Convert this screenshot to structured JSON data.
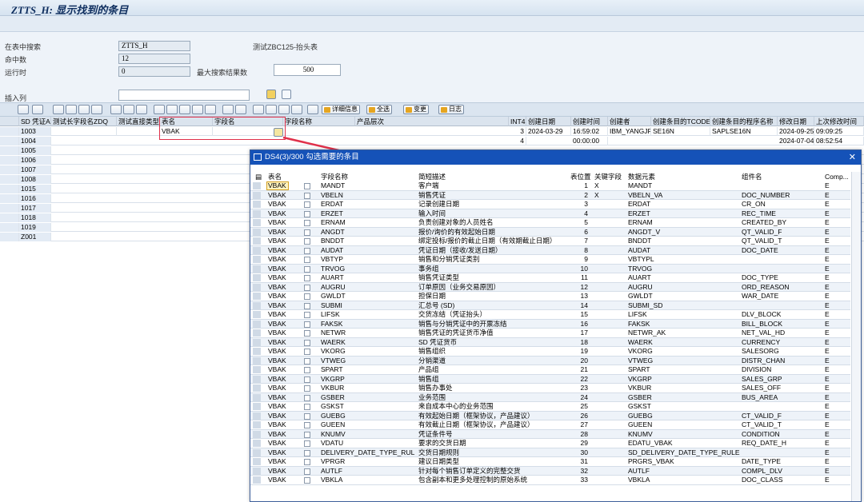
{
  "title": "ZTTS_H: 显示找到的条目",
  "toolbar_icons": [
    "refresh-icon",
    "filter-icon",
    "layout-icon",
    "export-icon"
  ],
  "form": {
    "search_table_label": "在表中搜索",
    "search_table_value": "ZTTS_H",
    "search_table_desc": "测试ZBC125-抬头表",
    "hits_label": "命中数",
    "hits_value": "12",
    "runtime_label": "运行时",
    "runtime_value": "0",
    "max_results_label": "最大搜索结果数",
    "max_results_value": "500",
    "insert_col_label": "插入列"
  },
  "alv_buttons": {
    "details": "详细信息",
    "select_all": "全选",
    "change": "变更",
    "log": "日志"
  },
  "grid": {
    "headers": [
      "SD 凭证A",
      "测试长字段名ZDQ",
      "测试直接类型",
      "表名",
      "字段名",
      "字段名称",
      "产品层次",
      "INT4",
      "创建日期",
      "创建时间",
      "创建者",
      "创建条目的TCODE",
      "创建条目的程序名称",
      "修改日期",
      "上次修改时间"
    ],
    "rows": [
      {
        "id": "1003",
        "table": "VBAK",
        "int4": "3",
        "cdate": "2024-03-29",
        "ctime": "16:59:02",
        "creator": "IBM_YANGJF",
        "tcode": "SE16N",
        "prog": "SAPLSE16N",
        "mdate": "2024-09-25",
        "mtime": "09:09:25"
      },
      {
        "id": "1004",
        "table": "",
        "int4": "4",
        "cdate": "",
        "ctime": "00:00:00",
        "creator": "",
        "tcode": "",
        "prog": "",
        "mdate": "2024-07-04",
        "mtime": "08:52:54"
      },
      {
        "id": "1005"
      },
      {
        "id": "1006"
      },
      {
        "id": "1007"
      },
      {
        "id": "1008"
      },
      {
        "id": "1015"
      },
      {
        "id": "1016"
      },
      {
        "id": "1017"
      },
      {
        "id": "1018"
      },
      {
        "id": "1019"
      },
      {
        "id": "Z001"
      }
    ]
  },
  "popup": {
    "title": "DS4(3)/300 勾选需要的条目",
    "headers": [
      "表名",
      "字段名称",
      "简短描述",
      "表位置",
      "关键字段",
      "数据元素",
      "组件名",
      "Comp..."
    ],
    "rows": [
      [
        "VBAK",
        "MANDT",
        "客户端",
        "1",
        "X",
        "MANDT",
        "",
        "E"
      ],
      [
        "VBAK",
        "VBELN",
        "销售凭证",
        "2",
        "X",
        "VBELN_VA",
        "DOC_NUMBER",
        "E"
      ],
      [
        "VBAK",
        "ERDAT",
        "记录创建日期",
        "3",
        "",
        "ERDAT",
        "CR_ON",
        "E"
      ],
      [
        "VBAK",
        "ERZET",
        "输入时间",
        "4",
        "",
        "ERZET",
        "REC_TIME",
        "E"
      ],
      [
        "VBAK",
        "ERNAM",
        "负责创建对象的人员姓名",
        "5",
        "",
        "ERNAM",
        "CREATED_BY",
        "E"
      ],
      [
        "VBAK",
        "ANGDT",
        "报价/询价的有效起始日期",
        "6",
        "",
        "ANGDT_V",
        "QT_VALID_F",
        "E"
      ],
      [
        "VBAK",
        "BNDDT",
        "绑定投标/报价的截止日期（有效期截止日期）",
        "7",
        "",
        "BNDDT",
        "QT_VALID_T",
        "E"
      ],
      [
        "VBAK",
        "AUDAT",
        "凭证日期（接收/发送日期）",
        "8",
        "",
        "AUDAT",
        "DOC_DATE",
        "E"
      ],
      [
        "VBAK",
        "VBTYP",
        "销售和分销凭证类别",
        "9",
        "",
        "VBTYPL",
        "",
        "E"
      ],
      [
        "VBAK",
        "TRVOG",
        "事务组",
        "10",
        "",
        "TRVOG",
        "",
        "E"
      ],
      [
        "VBAK",
        "AUART",
        "销售凭证类型",
        "11",
        "",
        "AUART",
        "DOC_TYPE",
        "E"
      ],
      [
        "VBAK",
        "AUGRU",
        "订单原因（业务交易原因）",
        "12",
        "",
        "AUGRU",
        "ORD_REASON",
        "E"
      ],
      [
        "VBAK",
        "GWLDT",
        "担保日期",
        "13",
        "",
        "GWLDT",
        "WAR_DATE",
        "E"
      ],
      [
        "VBAK",
        "SUBMI",
        "汇总号 (SD)",
        "14",
        "",
        "SUBMI_SD",
        "",
        "E"
      ],
      [
        "VBAK",
        "LIFSK",
        "交货冻结（凭证抬头）",
        "15",
        "",
        "LIFSK",
        "DLV_BLOCK",
        "E"
      ],
      [
        "VBAK",
        "FAKSK",
        "销售与分销凭证中的开票冻结",
        "16",
        "",
        "FAKSK",
        "BILL_BLOCK",
        "E"
      ],
      [
        "VBAK",
        "NETWR",
        "销售凭证的凭证货币净值",
        "17",
        "",
        "NETWR_AK",
        "NET_VAL_HD",
        "E"
      ],
      [
        "VBAK",
        "WAERK",
        "SD 凭证货币",
        "18",
        "",
        "WAERK",
        "CURRENCY",
        "E"
      ],
      [
        "VBAK",
        "VKORG",
        "销售组织",
        "19",
        "",
        "VKORG",
        "SALESORG",
        "E"
      ],
      [
        "VBAK",
        "VTWEG",
        "分销渠道",
        "20",
        "",
        "VTWEG",
        "DISTR_CHAN",
        "E"
      ],
      [
        "VBAK",
        "SPART",
        "产品组",
        "21",
        "",
        "SPART",
        "DIVISION",
        "E"
      ],
      [
        "VBAK",
        "VKGRP",
        "销售组",
        "22",
        "",
        "VKGRP",
        "SALES_GRP",
        "E"
      ],
      [
        "VBAK",
        "VKBUR",
        "销售办事处",
        "23",
        "",
        "VKBUR",
        "SALES_OFF",
        "E"
      ],
      [
        "VBAK",
        "GSBER",
        "业务范围",
        "24",
        "",
        "GSBER",
        "BUS_AREA",
        "E"
      ],
      [
        "VBAK",
        "GSKST",
        "来自成本中心的业务范围",
        "25",
        "",
        "GSKST",
        "",
        "E"
      ],
      [
        "VBAK",
        "GUEBG",
        "有效起始日期（框架协议，产品建议）",
        "26",
        "",
        "GUEBG",
        "CT_VALID_F",
        "E"
      ],
      [
        "VBAK",
        "GUEEN",
        "有效截止日期（框架协议，产品建议）",
        "27",
        "",
        "GUEEN",
        "CT_VALID_T",
        "E"
      ],
      [
        "VBAK",
        "KNUMV",
        "凭证条件号",
        "28",
        "",
        "KNUMV",
        "CONDITION",
        "E"
      ],
      [
        "VBAK",
        "VDATU",
        "要求的交货日期",
        "29",
        "",
        "EDATU_VBAK",
        "REQ_DATE_H",
        "E"
      ],
      [
        "VBAK",
        "DELIVERY_DATE_TYPE_RULE",
        "交货日期规则",
        "30",
        "",
        "SD_DELIVERY_DATE_TYPE_RULE",
        "",
        "E"
      ],
      [
        "VBAK",
        "VPRGR",
        "建议日期类型",
        "31",
        "",
        "PRGRS_VBAK",
        "DATE_TYPE",
        "E"
      ],
      [
        "VBAK",
        "AUTLF",
        "针对每个销售订单定义的完整交货",
        "32",
        "",
        "AUTLF",
        "COMPL_DLV",
        "E"
      ],
      [
        "VBAK",
        "VBKLA",
        "包含副本和更多处理控制的原始系统",
        "33",
        "",
        "VBKLA",
        "DOC_CLASS",
        "E"
      ]
    ]
  }
}
